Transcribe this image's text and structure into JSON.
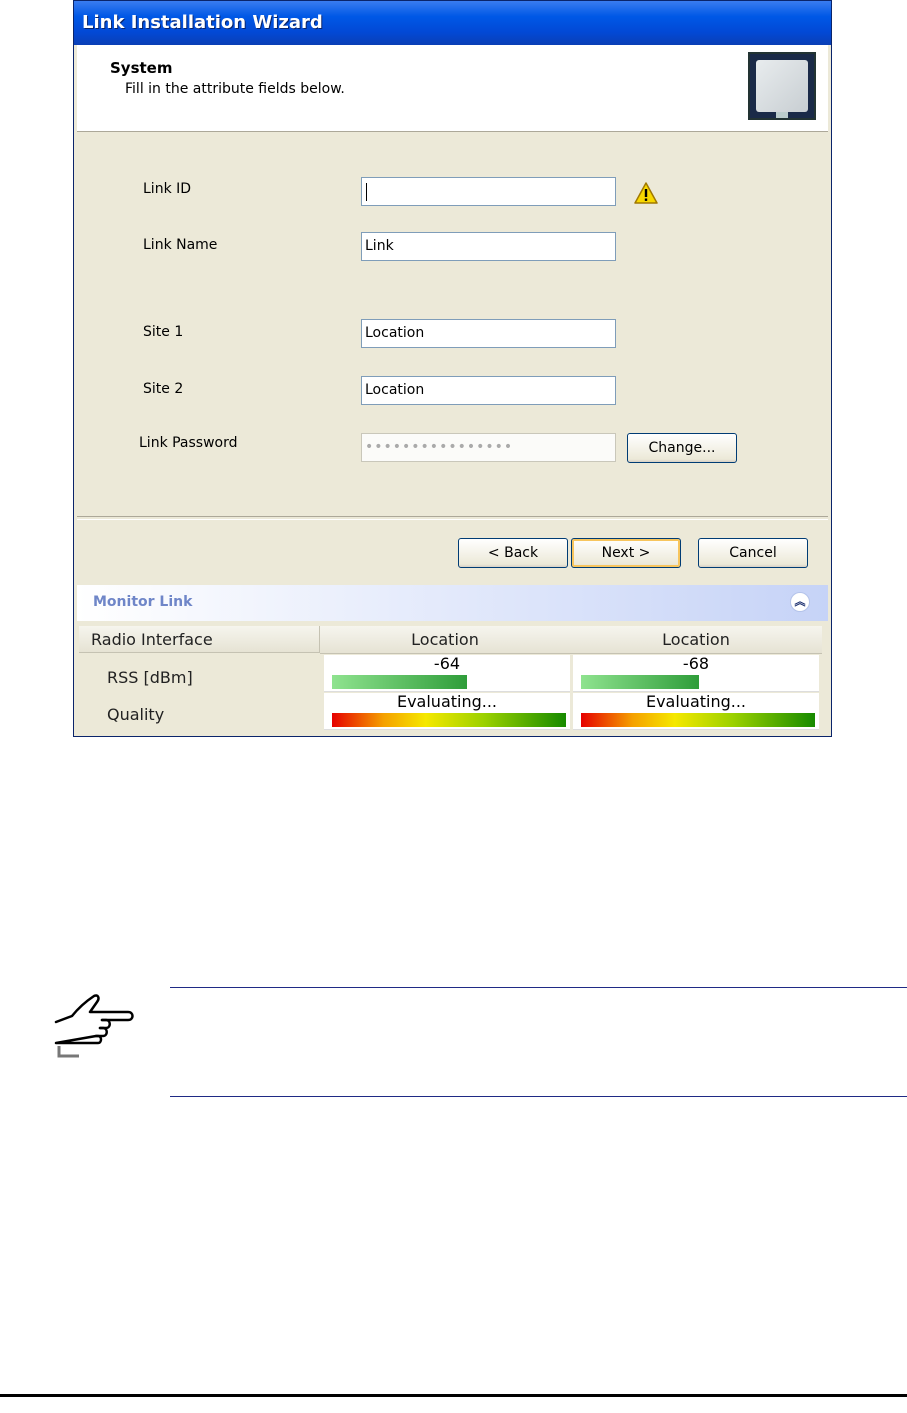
{
  "window": {
    "title": "Link Installation Wizard"
  },
  "header": {
    "title": "System",
    "subtitle": "Fill in the attribute fields below.",
    "icon": "odu-panel-icon"
  },
  "form": {
    "link_id": {
      "label": "Link ID",
      "value": ""
    },
    "link_name": {
      "label": "Link Name",
      "value": "Link"
    },
    "site1": {
      "label": "Site 1",
      "value": "Location"
    },
    "site2": {
      "label": "Site 2",
      "value": "Location"
    },
    "link_password": {
      "label": "Link Password",
      "value": "••••••••••••••••"
    },
    "change_button": "Change..."
  },
  "buttons": {
    "back": "< Back",
    "next": "Next >",
    "cancel": "Cancel"
  },
  "monitor": {
    "title": "Monitor Link",
    "columns": [
      "Radio Interface",
      "Location",
      "Location"
    ],
    "rows": {
      "rss": {
        "label": "RSS [dBm]",
        "values": [
          "-64",
          "-68"
        ],
        "levels": [
          0.57,
          0.5
        ]
      },
      "quality": {
        "label": "Quality",
        "values": [
          "Evaluating...",
          "Evaluating..."
        ]
      }
    }
  },
  "colors": {
    "title_bar": "#0249d6",
    "window_bg": "#ece9d8",
    "monitor_title": "#6f86c8"
  },
  "icons": {
    "warning": "warning-icon",
    "collapse": "collapse-icon",
    "note": "pointing-hand-icon"
  }
}
